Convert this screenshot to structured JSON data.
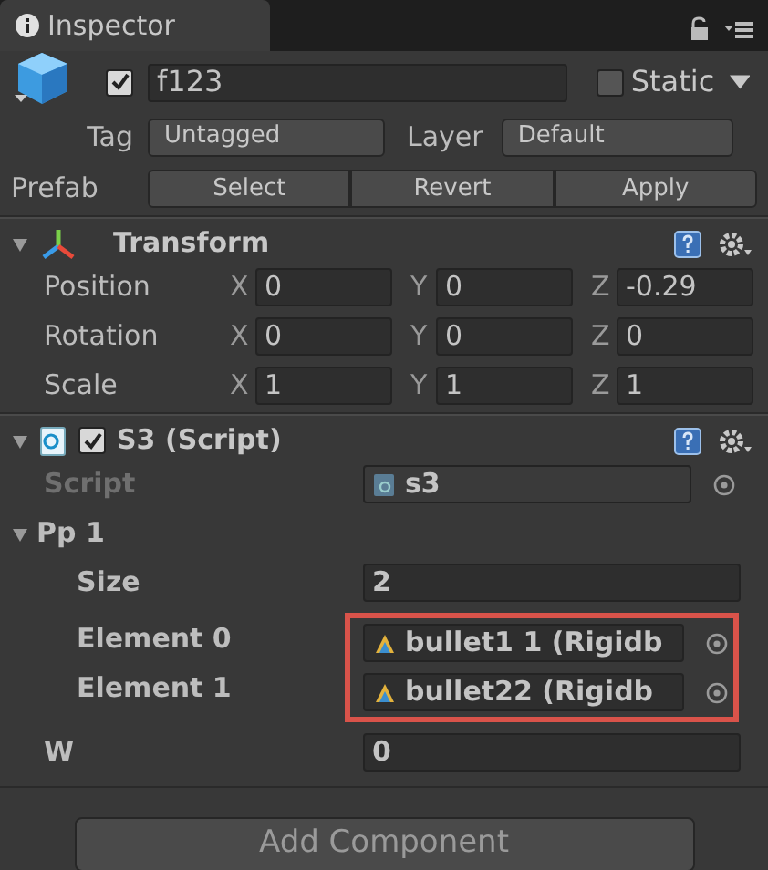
{
  "tab": {
    "title": "Inspector"
  },
  "object": {
    "active": true,
    "name": "f123",
    "static_label": "Static",
    "static": false,
    "tag": {
      "label": "Tag",
      "value": "Untagged"
    },
    "layer": {
      "label": "Layer",
      "value": "Default"
    },
    "prefab": {
      "label": "Prefab",
      "buttons": [
        "Select",
        "Revert",
        "Apply"
      ]
    }
  },
  "components": [
    {
      "kind": "transform",
      "title": "Transform",
      "expanded": true,
      "rows": [
        {
          "label": "Position",
          "axes": [
            {
              "axis": "X",
              "value": "0"
            },
            {
              "axis": "Y",
              "value": "0"
            },
            {
              "axis": "Z",
              "value": "-0.29"
            }
          ]
        },
        {
          "label": "Rotation",
          "axes": [
            {
              "axis": "X",
              "value": "0"
            },
            {
              "axis": "Y",
              "value": "0"
            },
            {
              "axis": "Z",
              "value": "0"
            }
          ]
        },
        {
          "label": "Scale",
          "axes": [
            {
              "axis": "X",
              "value": "1"
            },
            {
              "axis": "Y",
              "value": "1"
            },
            {
              "axis": "Z",
              "value": "1"
            }
          ]
        }
      ]
    },
    {
      "kind": "script",
      "title": "S3 (Script)",
      "enabled": true,
      "expanded": true,
      "fields": [
        {
          "kind": "object",
          "label": "Script",
          "value": "s3",
          "disabled": true
        },
        {
          "kind": "foldout",
          "label": "Pp 1",
          "expanded": true,
          "size": {
            "label": "Size",
            "value": "2"
          },
          "elements_highlighted": true,
          "elements": [
            {
              "label": "Element 0",
              "value": "bullet1 1 (Rigidb"
            },
            {
              "label": "Element 1",
              "value": "bullet22 (Rigidb"
            }
          ]
        },
        {
          "kind": "text",
          "label": "W",
          "value": "0"
        }
      ]
    }
  ],
  "add_button": "Add Component"
}
